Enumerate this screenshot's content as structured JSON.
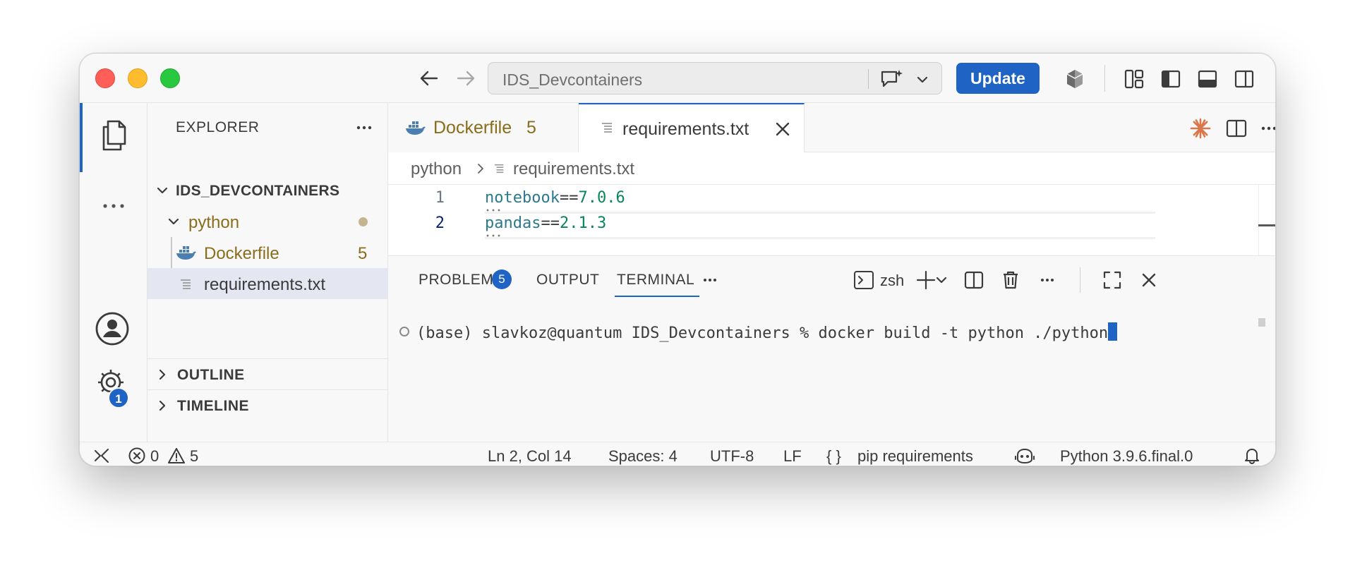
{
  "window": {
    "command_center": "IDS_Devcontainers",
    "update_label": "Update"
  },
  "activity": {
    "settings_badge": "1"
  },
  "sidebar": {
    "title": "EXPLORER",
    "root_folder": "IDS_DEVCONTAINERS",
    "folder": "python",
    "files": [
      {
        "name": "Dockerfile",
        "badge": "5"
      },
      {
        "name": "requirements.txt"
      }
    ],
    "sections": [
      "OUTLINE",
      "TIMELINE"
    ]
  },
  "tabs": [
    {
      "label": "Dockerfile",
      "badge": "5"
    },
    {
      "label": "requirements.txt"
    }
  ],
  "breadcrumb": [
    "python",
    "requirements.txt"
  ],
  "code": {
    "lines": [
      {
        "no": "1",
        "name": "notebook",
        "op": "==",
        "version": "7.0.6"
      },
      {
        "no": "2",
        "name": "pandas",
        "op": "==",
        "version": "2.1.3"
      }
    ]
  },
  "panel": {
    "tabs": [
      {
        "label": "PROBLEMS",
        "badge": "5"
      },
      {
        "label": "OUTPUT"
      },
      {
        "label": "TERMINAL"
      }
    ],
    "active_tab": "TERMINAL",
    "shell": "zsh",
    "terminal_line": "(base) slavkoz@quantum IDS_Devcontainers % docker build -t python ./python"
  },
  "statusbar": {
    "errors": "0",
    "warnings": "5",
    "position": "Ln 2, Col 14",
    "spaces": "Spaces: 4",
    "encoding": "UTF-8",
    "eol": "LF",
    "braces": "{ }",
    "language": "pip requirements",
    "interpreter": "Python 3.9.6.final.0"
  },
  "colors": {
    "accent": "#1f63c4",
    "modified": "#8a6d1a",
    "traffic_red": "#ff5f57",
    "traffic_yellow": "#febc2e",
    "traffic_green": "#28c840",
    "copilot_spark": "#d9774a"
  }
}
